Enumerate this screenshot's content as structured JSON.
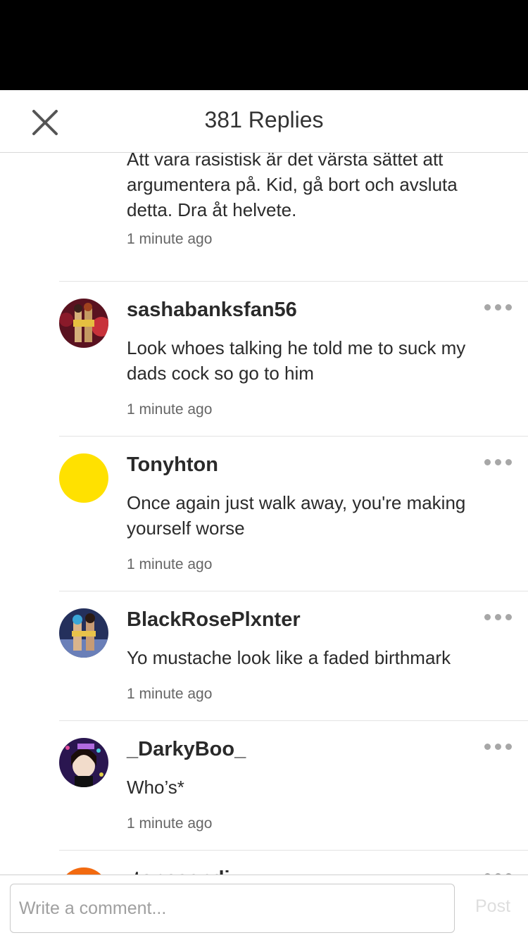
{
  "header": {
    "title": "381 Replies",
    "close_icon": "close-icon"
  },
  "replies": [
    {
      "username": "",
      "body": "Att vara rasistisk är det värsta sättet att argumentera på. Kid, gå bort och avsluta detta. Dra åt helvete.",
      "time": "1 minute ago",
      "avatar_color": "#f07a20"
    },
    {
      "username": "sashabanksfan56",
      "body": "Look whoes talking he told me to suck my dads cock so go to him",
      "time": "1 minute ago",
      "avatar_color": "#6b1b2b"
    },
    {
      "username": "Tonyhton",
      "body": "Once again just walk away, you're making yourself worse",
      "time": "1 minute ago",
      "avatar_color": "#ffe100"
    },
    {
      "username": "BlackRosePlxnter",
      "body": "Yo mustache look like a faded birthmark",
      "time": "1 minute ago",
      "avatar_color": "#2b3a6a"
    },
    {
      "username": "_DarkyBoo_",
      "body": "Who’s*",
      "time": "1 minute ago",
      "avatar_color": "#2a1650"
    },
    {
      "username": "-tonesandi",
      "body": "",
      "time": "",
      "avatar_color": "#f26a10"
    }
  ],
  "composer": {
    "placeholder": "Write a comment...",
    "post_label": "Post"
  },
  "icons": {
    "more": "more-options-icon",
    "avatar": "avatar"
  }
}
